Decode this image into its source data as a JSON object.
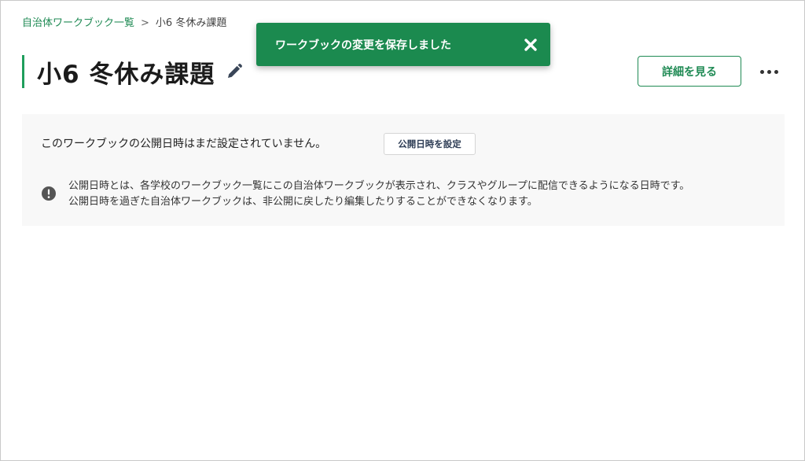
{
  "breadcrumb": {
    "parent": "自治体ワークブック一覧",
    "separator": ">",
    "current": "小6 冬休み課題"
  },
  "page": {
    "title": "小6 冬休み課題",
    "accent_color": "#1f9e5c"
  },
  "toast": {
    "message": "ワークブックの変更を保存しました",
    "background": "#1b8a4f",
    "close_icon": "close-icon"
  },
  "header_actions": {
    "detail_label": "詳細を見る",
    "more_icon": "more-horizontal-icon"
  },
  "publish_notice": {
    "status_text": "このワークブックの公開日時はまだ設定されていません。",
    "set_button_label": "公開日時を設定",
    "info_icon": "exclamation-circle-icon",
    "info_line_1": "公開日時とは、各学校のワークブック一覧にこの自治体ワークブックが表示され、クラスやグループに配信できるようになる日時です。",
    "info_line_2": "公開日時を過ぎた自治体ワークブックは、非公開に戻したり編集したりすることができなくなります。"
  }
}
